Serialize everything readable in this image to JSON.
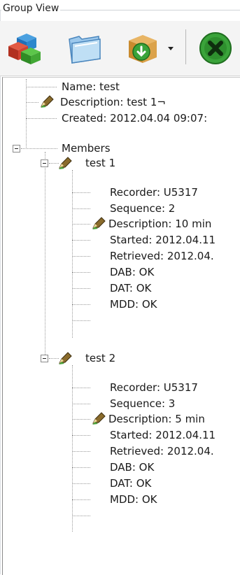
{
  "panel": {
    "title": "Group View"
  },
  "toolbar": {
    "buttons": [
      {
        "name": "cubes-icon"
      },
      {
        "name": "folder-icon"
      },
      {
        "name": "download-box-icon"
      },
      {
        "name": "dropdown-arrow-icon"
      },
      {
        "name": "delete-icon"
      }
    ]
  },
  "tree": {
    "name": "Name: test",
    "description": "Description: test 1¬",
    "created": "Created: 2012.04.04 09:07:",
    "members_label": "Members",
    "members": [
      {
        "label": "test 1",
        "recorder": "Recorder: U5317",
        "sequence": "Sequence: 2",
        "description": "Description: 10 min",
        "started": "Started: 2012.04.11",
        "retrieved": "Retrieved: 2012.04.",
        "dab": "DAB: OK",
        "dat": "DAT: OK",
        "mdd": "MDD: OK"
      },
      {
        "label": "test 2",
        "recorder": "Recorder: U5317",
        "sequence": "Sequence: 3",
        "description": "Description: 5 min",
        "started": "Started: 2012.04.11",
        "retrieved": "Retrieved: 2012.04.",
        "dab": "DAB: OK",
        "dat": "DAT: OK",
        "mdd": "MDD: OK"
      }
    ]
  },
  "colors": {
    "accent": "#3aa33a",
    "pen": "#6b5a2a",
    "tree_line": "#9a9a9a"
  }
}
